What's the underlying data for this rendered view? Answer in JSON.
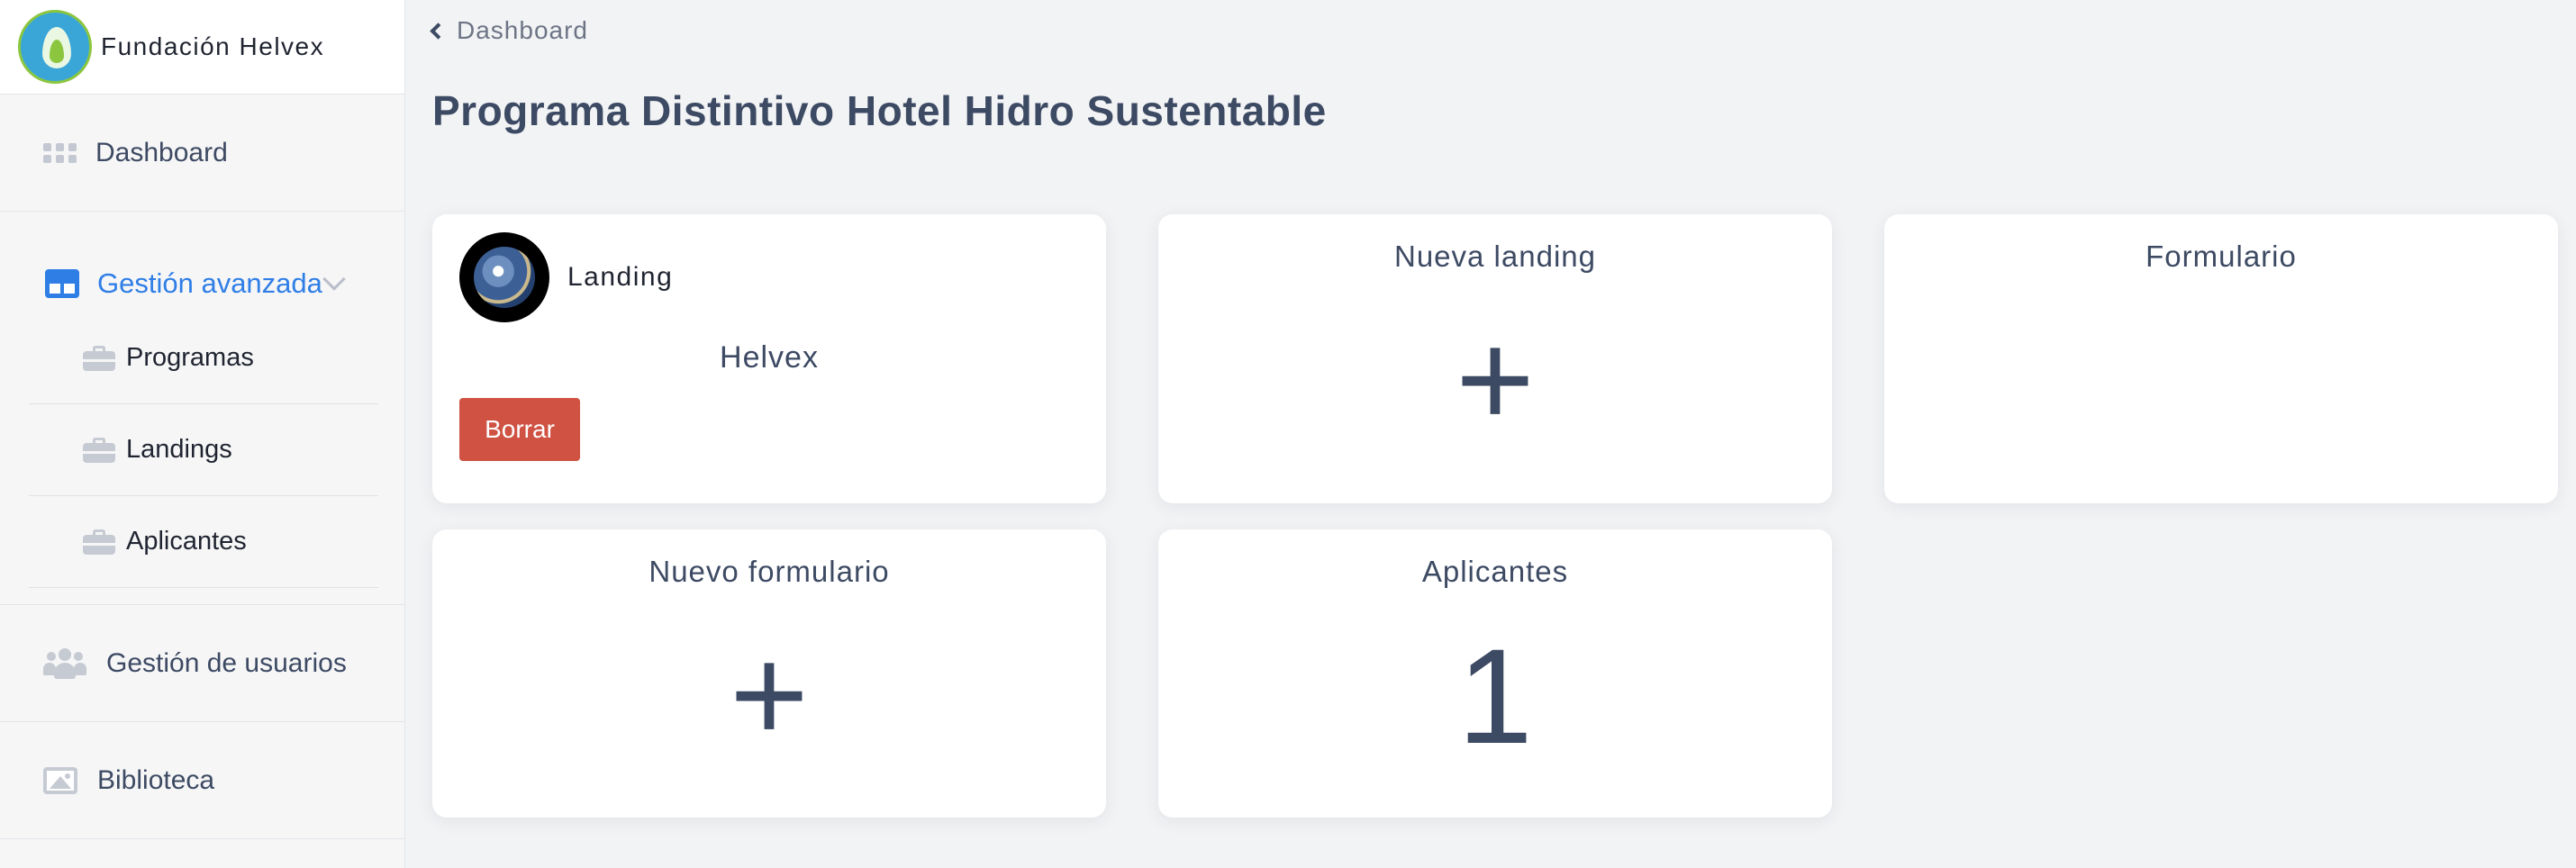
{
  "brand": {
    "name": "Fundación Helvex"
  },
  "sidebar": {
    "dashboard": "Dashboard",
    "group": {
      "label": "Gestión avanzada",
      "items": [
        {
          "label": "Programas"
        },
        {
          "label": "Landings"
        },
        {
          "label": "Aplicantes"
        }
      ]
    },
    "users": "Gestión de usuarios",
    "library": "Biblioteca"
  },
  "breadcrumb": {
    "label": "Dashboard"
  },
  "page": {
    "title": "Programa Distintivo Hotel Hidro Sustentable"
  },
  "cards": {
    "landing": {
      "label": "Landing",
      "name": "Helvex",
      "delete_label": "Borrar"
    },
    "new_landing": {
      "title": "Nueva landing",
      "symbol": "+"
    },
    "form": {
      "title": "Formulario"
    },
    "new_form": {
      "title": "Nuevo formulario",
      "symbol": "+"
    },
    "applicants": {
      "title": "Aplicantes",
      "count": "1"
    }
  },
  "colors": {
    "accent": "#2f7ee6",
    "danger": "#cf5243",
    "text": "#3d4a63",
    "background": "#f2f3f5"
  }
}
